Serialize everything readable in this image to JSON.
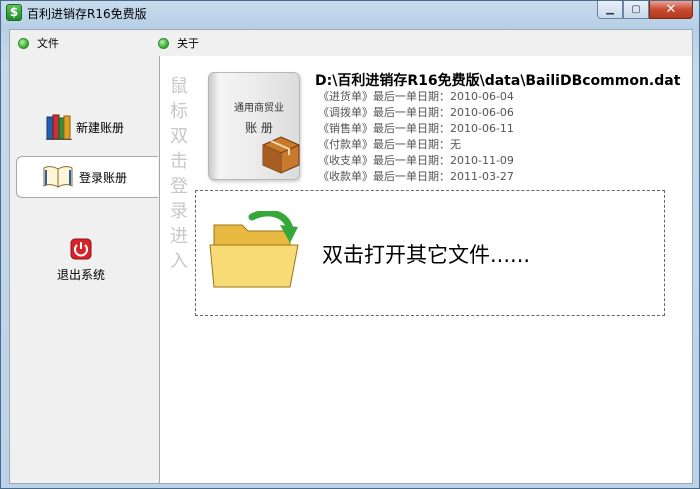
{
  "window": {
    "title": "百利进销存R16免费版",
    "app_icon_glyph": "$",
    "controls": {
      "minimize": "▁",
      "maximize": "▢",
      "close": "✕"
    }
  },
  "menu": [
    {
      "label": "文件",
      "icon": "green-dot-icon"
    },
    {
      "label": "关于",
      "icon": "green-dot-icon"
    }
  ],
  "sidebar": {
    "items": [
      {
        "label": "新建账册",
        "icon": "books-icon"
      },
      {
        "label": "登录账册",
        "icon": "open-book-icon",
        "active": true
      },
      {
        "label": "退出系统",
        "icon": "power-icon"
      }
    ]
  },
  "main": {
    "vertical_hint": [
      "鼠",
      "标",
      "双",
      "击",
      "登",
      "录",
      "进",
      "入"
    ],
    "book": {
      "line1": "通用商贸业",
      "line2": "账 册"
    },
    "file_path": "D:\\百利进销存R16免费版\\data\\BailiDBcommon.dat",
    "last_dates": [
      "《进货单》最后一单日期：2010-06-04",
      "《调拨单》最后一单日期：2010-06-06",
      "《销售单》最后一单日期：2010-06-11",
      "《付款单》最后一单日期：无",
      "《收支单》最后一单日期：2010-11-09",
      "《收款单》最后一单日期：2011-03-27"
    ],
    "open_other_label": "双击打开其它文件......"
  },
  "colors": {
    "accent_green": "#3fb53a",
    "close_red": "#c74a2f",
    "folder_yellow": "#f5d36a",
    "power_red": "#d8232a"
  }
}
